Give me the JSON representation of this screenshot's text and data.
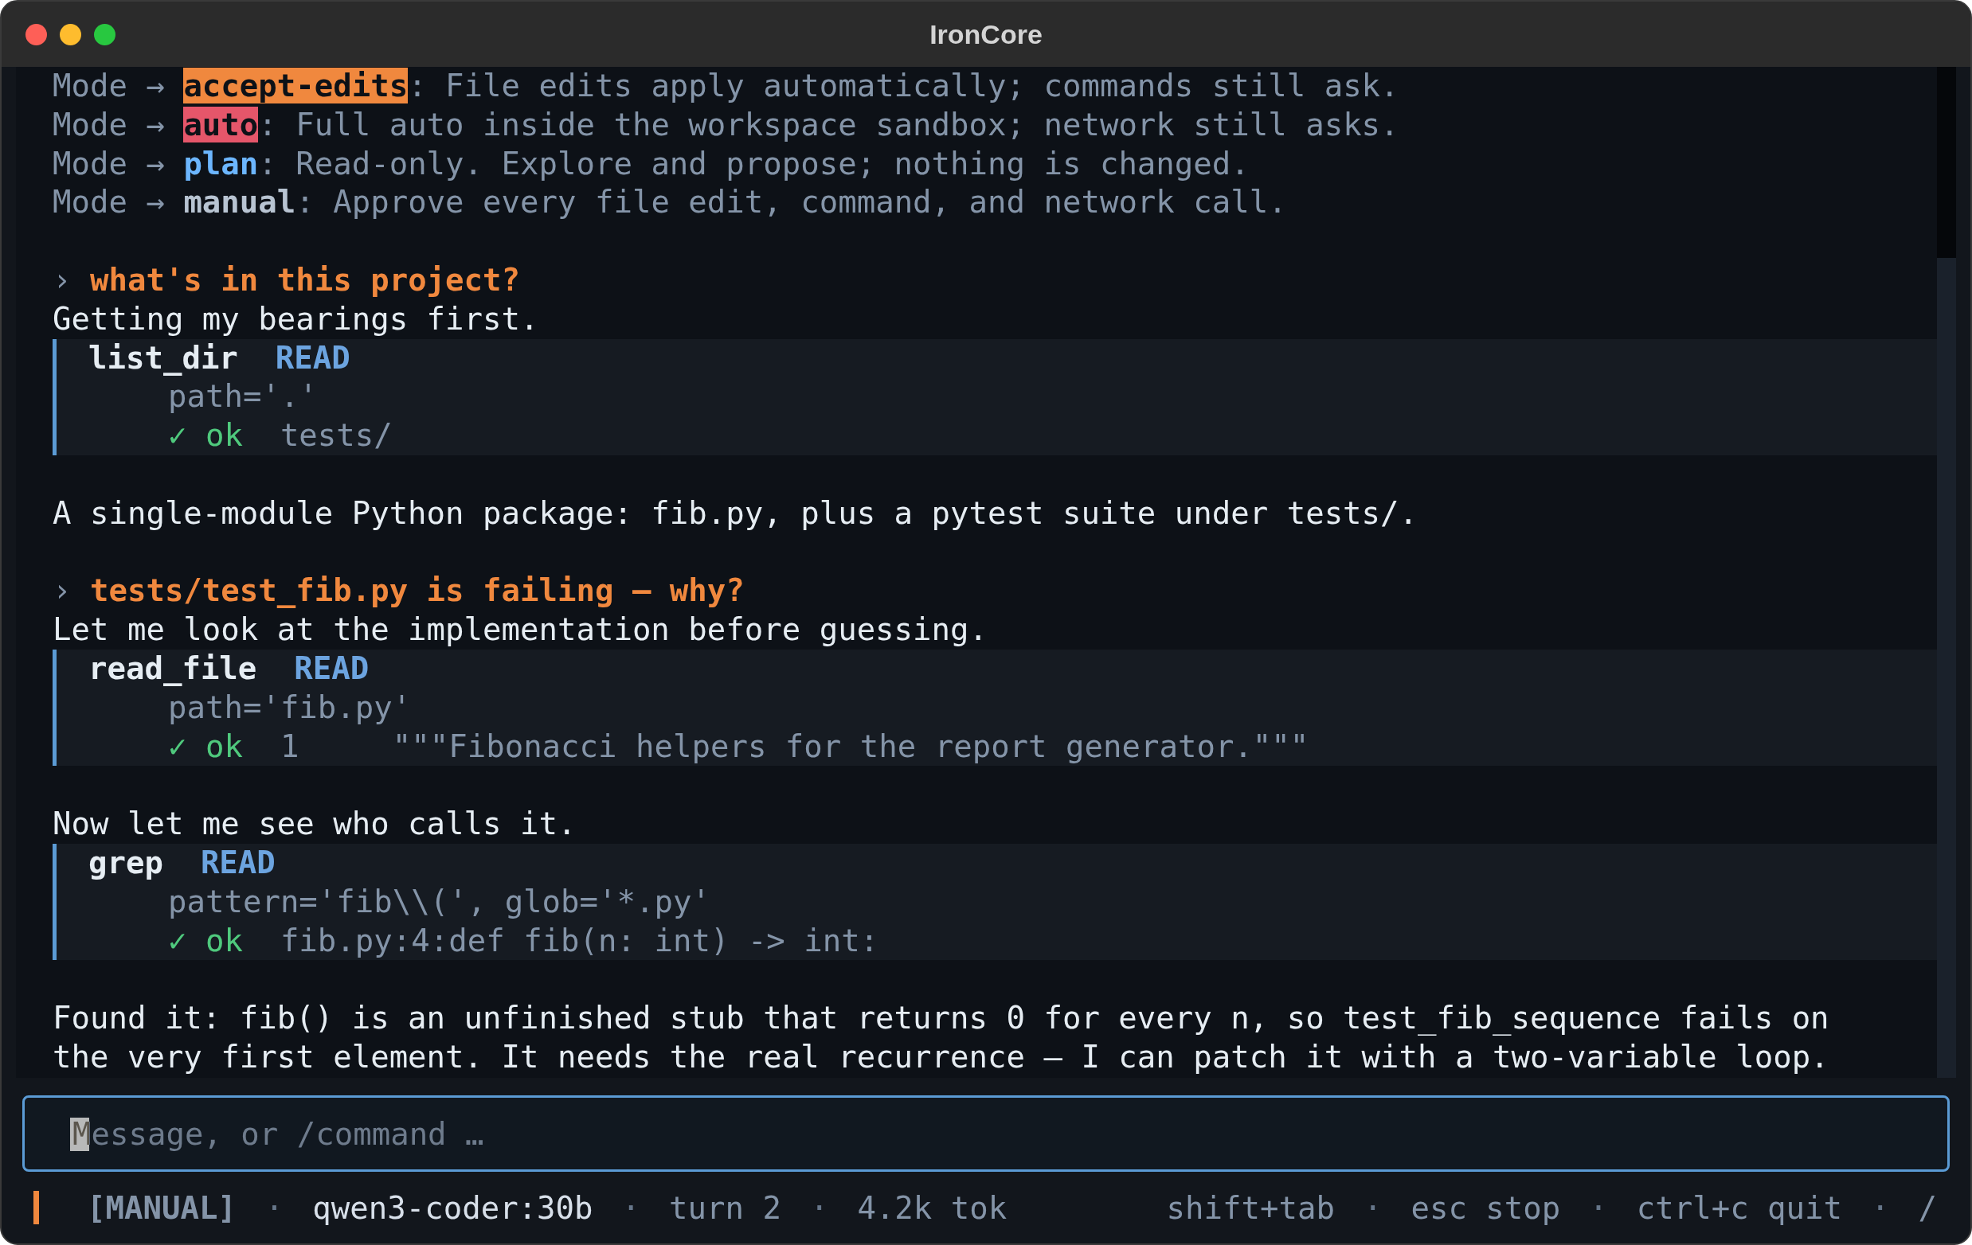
{
  "window": {
    "title": "IronCore"
  },
  "mode_lines": [
    {
      "prefix": "Mode →",
      "mode": "accept-edits",
      "kind": "accept-edits",
      "description": ": File edits apply automatically; commands still ask."
    },
    {
      "prefix": "Mode →",
      "mode": "auto",
      "kind": "auto",
      "description": ": Full auto inside the workspace sandbox; network still asks."
    },
    {
      "prefix": "Mode →",
      "mode": "plan",
      "kind": "plan",
      "description": ": Read-only. Explore and propose; nothing is changed."
    },
    {
      "prefix": "Mode →",
      "mode": "manual",
      "kind": "manual",
      "description": ": Approve every file edit, command, and network call."
    }
  ],
  "transcript": [
    {
      "kind": "prompt",
      "marker": "›",
      "text": "what's in this project?"
    },
    {
      "kind": "text",
      "text": "Getting my bearings first."
    },
    {
      "kind": "tool",
      "name": "list_dir",
      "access": "READ",
      "args": "path='.'",
      "status": "✓ ok",
      "result": "tests/"
    },
    {
      "kind": "text",
      "text": "A single-module Python package: fib.py, plus a pytest suite under tests/."
    },
    {
      "kind": "prompt",
      "marker": "›",
      "text": "tests/test_fib.py is failing — why?"
    },
    {
      "kind": "text",
      "text": "Let me look at the implementation before guessing."
    },
    {
      "kind": "tool",
      "name": "read_file",
      "access": "READ",
      "args": "path='fib.py'",
      "status": "✓ ok",
      "result": "1     \"\"\"Fibonacci helpers for the report generator.\"\"\""
    },
    {
      "kind": "text",
      "text": "Now let me see who calls it."
    },
    {
      "kind": "tool",
      "name": "grep",
      "access": "READ",
      "args": "pattern='fib\\\\(', glob='*.py'",
      "status": "✓ ok",
      "result": "fib.py:4:def fib(n: int) -> int:"
    },
    {
      "kind": "text",
      "text": "Found it: fib() is an unfinished stub that returns 0 for every n, so test_fib_sequence fails on the very first element. It needs the real recurrence — I can patch it with a two-variable loop."
    }
  ],
  "input": {
    "placeholder": "Message, or /command …"
  },
  "status_bar": {
    "left": [
      {
        "kind": "mode",
        "text": "[MANUAL]"
      },
      {
        "kind": "sep",
        "text": "·"
      },
      {
        "kind": "model",
        "text": "qwen3-coder:30b"
      },
      {
        "kind": "sep",
        "text": "·"
      },
      {
        "kind": "info",
        "text": "turn 2"
      },
      {
        "kind": "sep",
        "text": "·"
      },
      {
        "kind": "info",
        "text": "4.2k tok"
      }
    ],
    "right": [
      {
        "kind": "info",
        "text": "shift+tab"
      },
      {
        "kind": "sep",
        "text": "·"
      },
      {
        "kind": "info",
        "text": "esc stop"
      },
      {
        "kind": "sep",
        "text": "·"
      },
      {
        "kind": "info",
        "text": "ctrl+c quit"
      },
      {
        "kind": "sep",
        "text": "·"
      },
      {
        "kind": "info",
        "text": "/"
      }
    ]
  }
}
